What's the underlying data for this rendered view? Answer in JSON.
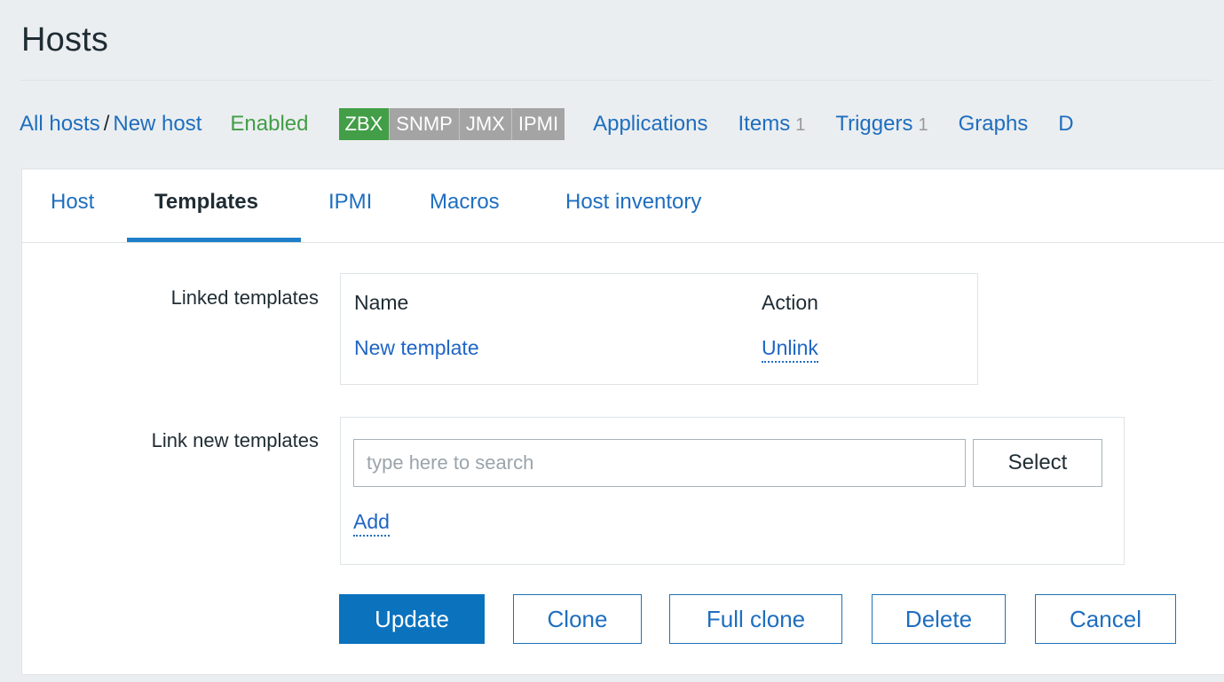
{
  "page": {
    "title": "Hosts"
  },
  "host_nav": {
    "breadcrumb": {
      "all_hosts": "All hosts",
      "separator": "/",
      "current": "New host"
    },
    "status": "Enabled",
    "availability": [
      "ZBX",
      "SNMP",
      "JMX",
      "IPMI"
    ],
    "links": [
      {
        "label": "Applications",
        "count": ""
      },
      {
        "label": "Items",
        "count": "1"
      },
      {
        "label": "Triggers",
        "count": "1"
      },
      {
        "label": "Graphs",
        "count": ""
      },
      {
        "label": "D",
        "count": ""
      }
    ]
  },
  "tabs": [
    "Host",
    "Templates",
    "IPMI",
    "Macros",
    "Host inventory"
  ],
  "active_tab": "Templates",
  "linked_templates": {
    "label": "Linked templates",
    "columns": [
      "Name",
      "Action"
    ],
    "rows": [
      {
        "name": "New template",
        "action": "Unlink"
      }
    ]
  },
  "link_new_templates": {
    "label": "Link new templates",
    "search_placeholder": "type here to search",
    "search_value": "",
    "select_label": "Select",
    "add_label": "Add"
  },
  "buttons": {
    "update": "Update",
    "clone": "Clone",
    "full_clone": "Full clone",
    "delete": "Delete",
    "cancel": "Cancel"
  },
  "colors": {
    "link": "#1e6ebf",
    "enabled": "#429e47",
    "zbx_badge": "#429e47",
    "inactive_badge": "#a4a4a4",
    "primary_button": "#0b72be",
    "tab_underline": "#1e7fc8"
  }
}
